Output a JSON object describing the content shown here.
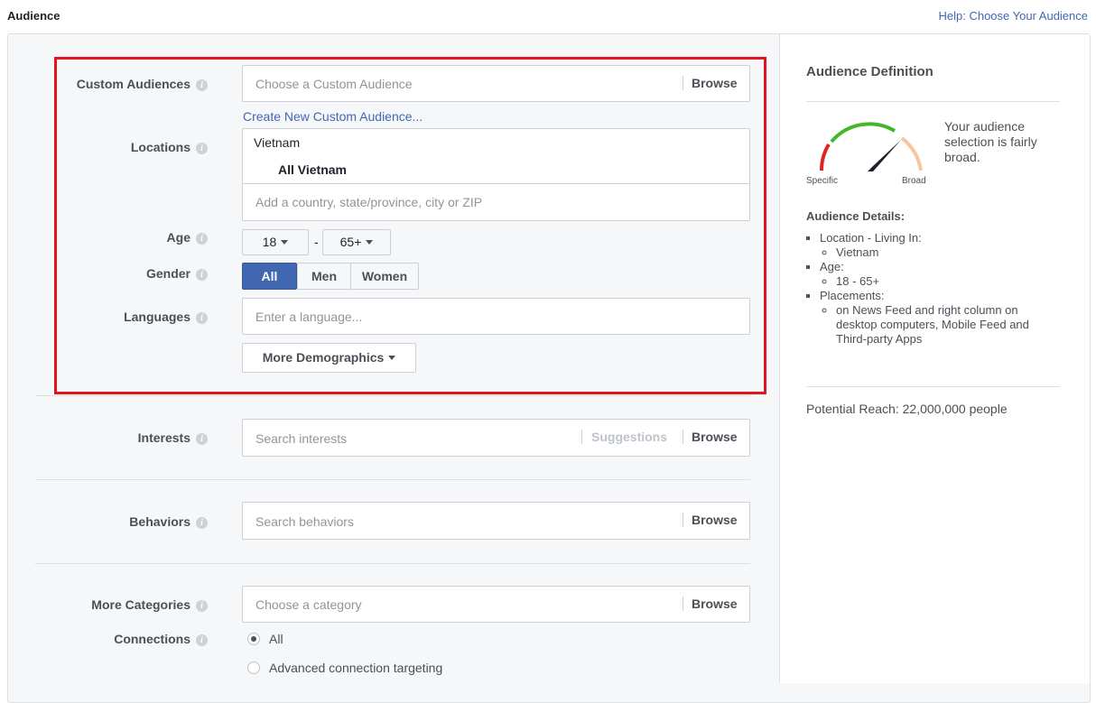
{
  "header": {
    "title": "Audience",
    "help_link": "Help: Choose Your Audience"
  },
  "form": {
    "custom_audiences": {
      "label": "Custom Audiences",
      "placeholder": "Choose a Custom Audience",
      "browse": "Browse",
      "create_link": "Create New Custom Audience..."
    },
    "locations": {
      "label": "Locations",
      "country": "Vietnam",
      "selection": "All Vietnam",
      "placeholder": "Add a country, state/province, city or ZIP"
    },
    "age": {
      "label": "Age",
      "min": "18",
      "dash": "-",
      "max": "65+"
    },
    "gender": {
      "label": "Gender",
      "options": [
        "All",
        "Men",
        "Women"
      ],
      "selected": "All"
    },
    "languages": {
      "label": "Languages",
      "placeholder": "Enter a language..."
    },
    "more_demographics": {
      "label": "More Demographics"
    },
    "interests": {
      "label": "Interests",
      "placeholder": "Search interests",
      "suggestions": "Suggestions",
      "browse": "Browse"
    },
    "behaviors": {
      "label": "Behaviors",
      "placeholder": "Search behaviors",
      "browse": "Browse"
    },
    "more_categories": {
      "label": "More Categories",
      "placeholder": "Choose a category",
      "browse": "Browse"
    },
    "connections": {
      "label": "Connections",
      "options": [
        "All",
        "Advanced connection targeting"
      ],
      "selected": "All"
    }
  },
  "sidebar": {
    "title": "Audience Definition",
    "gauge": {
      "specific_label": "Specific",
      "broad_label": "Broad",
      "message": "Your audience selection is fairly broad.",
      "colors": {
        "low": "#e02424",
        "mid": "#42b72a",
        "high": "#f7c59f",
        "needle": "#1d2129"
      }
    },
    "details_title": "Audience Details:",
    "details": {
      "location_label": "Location - Living In:",
      "location_value": "Vietnam",
      "age_label": "Age:",
      "age_value": "18 - 65+",
      "placements_label": "Placements:",
      "placements_value": "on News Feed and right column on desktop computers, Mobile Feed and Third-party Apps"
    },
    "potential_reach": "Potential Reach: 22,000,000 people"
  },
  "colors": {
    "highlight": "#e4131e",
    "link": "#4267b2",
    "selected_button": "#4267b2"
  }
}
